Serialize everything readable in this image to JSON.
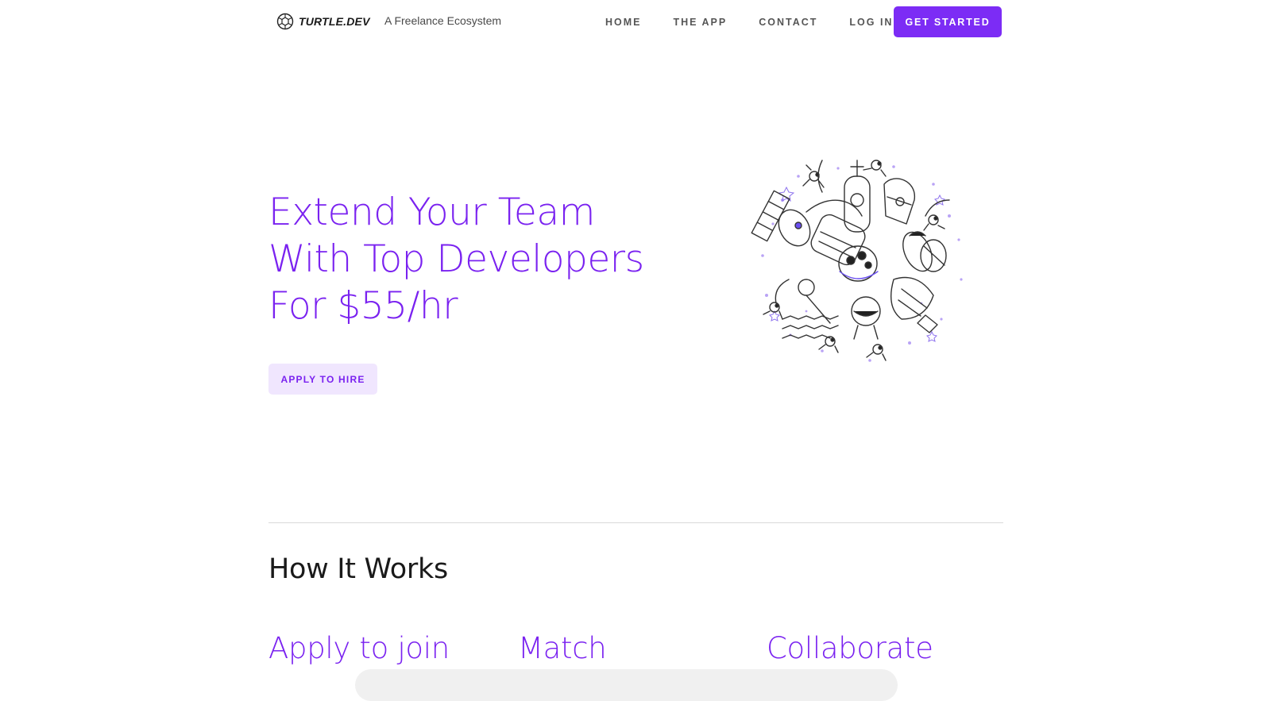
{
  "brand": {
    "name": "TURTLE.DEV",
    "logo_icon": "turtle-shell-icon",
    "tagline": "A Freelance Ecosystem"
  },
  "nav": {
    "links": [
      "HOME",
      "THE APP",
      "CONTACT",
      "LOG IN"
    ],
    "cta": "GET STARTED"
  },
  "hero": {
    "title_lines": [
      "Extend Your Team",
      "With Top Developers",
      "For $55/hr"
    ],
    "button": "APPLY TO HIRE",
    "illustration_icon": "space-station-illustration"
  },
  "how_it_works": {
    "title": "How It Works",
    "steps": [
      "Apply to join",
      "Match",
      "Collaborate"
    ]
  },
  "colors": {
    "accent": "#7c2cf5",
    "accent_light": "#f0e6fe",
    "heading": "#1a1a1a",
    "nav_text": "#555555",
    "divider": "#d9d9d9"
  }
}
